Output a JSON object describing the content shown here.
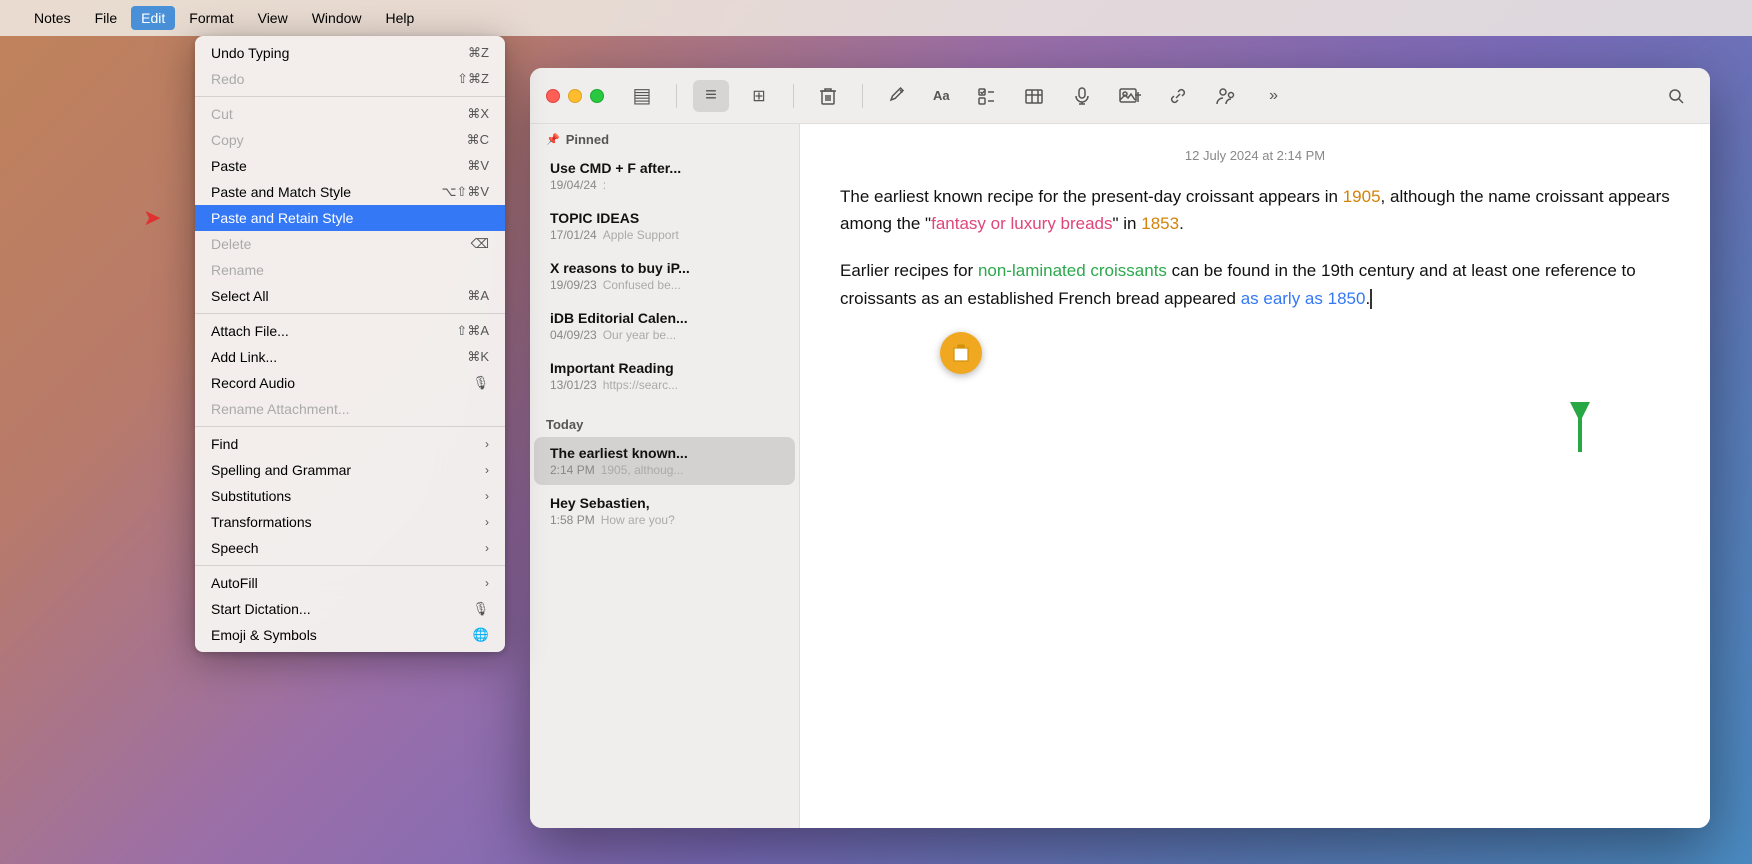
{
  "menuBar": {
    "apple": "",
    "items": [
      {
        "label": "Notes",
        "active": false
      },
      {
        "label": "File",
        "active": false
      },
      {
        "label": "Edit",
        "active": true
      },
      {
        "label": "Format",
        "active": false
      },
      {
        "label": "View",
        "active": false
      },
      {
        "label": "Window",
        "active": false
      },
      {
        "label": "Help",
        "active": false
      }
    ]
  },
  "dropdown": {
    "items": [
      {
        "id": "undo-typing",
        "label": "Undo Typing",
        "shortcut": "⌘Z",
        "disabled": false,
        "separator_after": false
      },
      {
        "id": "redo",
        "label": "Redo",
        "shortcut": "⇧⌘Z",
        "disabled": true,
        "separator_after": true
      },
      {
        "id": "cut",
        "label": "Cut",
        "shortcut": "⌘X",
        "disabled": true,
        "separator_after": false
      },
      {
        "id": "copy",
        "label": "Copy",
        "shortcut": "⌘C",
        "disabled": true,
        "separator_after": false
      },
      {
        "id": "paste",
        "label": "Paste",
        "shortcut": "⌘V",
        "disabled": false,
        "separator_after": false
      },
      {
        "id": "paste-match-style",
        "label": "Paste and Match Style",
        "shortcut": "⌥⇧⌘V",
        "disabled": false,
        "separator_after": false
      },
      {
        "id": "paste-retain-style",
        "label": "Paste and Retain Style",
        "shortcut": "",
        "disabled": false,
        "highlighted": true,
        "separator_after": false
      },
      {
        "id": "delete",
        "label": "Delete",
        "shortcut": "⌫",
        "disabled": true,
        "separator_after": false
      },
      {
        "id": "rename",
        "label": "Rename",
        "shortcut": "",
        "disabled": true,
        "separator_after": false
      },
      {
        "id": "select-all",
        "label": "Select All",
        "shortcut": "⌘A",
        "disabled": false,
        "separator_after": true
      },
      {
        "id": "attach-file",
        "label": "Attach File...",
        "shortcut": "⇧⌘A",
        "disabled": false,
        "separator_after": false
      },
      {
        "id": "add-link",
        "label": "Add Link...",
        "shortcut": "⌘K",
        "disabled": false,
        "separator_after": false
      },
      {
        "id": "record-audio",
        "label": "Record Audio",
        "shortcut": "🎙",
        "disabled": false,
        "separator_after": false
      },
      {
        "id": "rename-attachment",
        "label": "Rename Attachment...",
        "shortcut": "",
        "disabled": true,
        "separator_after": true
      },
      {
        "id": "find",
        "label": "Find",
        "shortcut": "",
        "arrow": true,
        "disabled": false,
        "separator_after": false
      },
      {
        "id": "spelling-grammar",
        "label": "Spelling and Grammar",
        "shortcut": "",
        "arrow": true,
        "disabled": false,
        "separator_after": false
      },
      {
        "id": "substitutions",
        "label": "Substitutions",
        "shortcut": "",
        "arrow": true,
        "disabled": false,
        "separator_after": false
      },
      {
        "id": "transformations",
        "label": "Transformations",
        "shortcut": "",
        "arrow": true,
        "disabled": false,
        "separator_after": false
      },
      {
        "id": "speech",
        "label": "Speech",
        "shortcut": "",
        "arrow": true,
        "disabled": false,
        "separator_after": true
      },
      {
        "id": "autofill",
        "label": "AutoFill",
        "shortcut": "",
        "arrow": true,
        "disabled": false,
        "separator_after": false
      },
      {
        "id": "start-dictation",
        "label": "Start Dictation...",
        "shortcut": "🎙",
        "disabled": false,
        "separator_after": false
      },
      {
        "id": "emoji-symbols",
        "label": "Emoji & Symbols",
        "shortcut": "🌐",
        "disabled": false,
        "separator_after": false
      }
    ]
  },
  "toolbar": {
    "buttons": [
      {
        "id": "sidebar-toggle",
        "icon": "▤",
        "label": "sidebar toggle"
      },
      {
        "id": "list-view",
        "icon": "≡",
        "label": "list view",
        "active": true
      },
      {
        "id": "gallery-view",
        "icon": "⊞",
        "label": "gallery view"
      },
      {
        "id": "trash",
        "icon": "🗑",
        "label": "trash"
      },
      {
        "id": "compose",
        "icon": "✏",
        "label": "compose"
      },
      {
        "id": "format-aa",
        "icon": "Aa",
        "label": "format"
      },
      {
        "id": "checklist",
        "icon": "☑",
        "label": "checklist"
      },
      {
        "id": "table",
        "icon": "⊞",
        "label": "table"
      },
      {
        "id": "audio",
        "icon": "🎵",
        "label": "audio"
      },
      {
        "id": "photo",
        "icon": "🖼",
        "label": "photo"
      },
      {
        "id": "link",
        "icon": "🔗",
        "label": "link"
      },
      {
        "id": "collab",
        "icon": "👥",
        "label": "collaborate"
      },
      {
        "id": "more",
        "icon": "»",
        "label": "more"
      },
      {
        "id": "search",
        "icon": "🔍",
        "label": "search"
      }
    ]
  },
  "sidebar": {
    "pinned_label": "Pinned",
    "today_label": "Today",
    "notes": [
      {
        "id": "use-cmd-f",
        "title": "Use CMD + F after...",
        "date": "19/04/24",
        "preview": ":",
        "pinned": true
      },
      {
        "id": "topic-ideas",
        "title": "TOPIC IDEAS",
        "date": "17/01/24",
        "preview": "Apple Support",
        "pinned": true
      },
      {
        "id": "x-reasons",
        "title": "X reasons to buy iP...",
        "date": "19/09/23",
        "preview": "Confused be...",
        "pinned": true
      },
      {
        "id": "idb-editorial",
        "title": "iDB Editorial Calen...",
        "date": "04/09/23",
        "preview": "Our year be...",
        "pinned": true
      },
      {
        "id": "important-reading",
        "title": "Important Reading",
        "date": "13/01/23",
        "preview": "https://searc...",
        "pinned": true
      },
      {
        "id": "earliest-known",
        "title": "The earliest known...",
        "date": "2:14 PM",
        "preview": "1905, althoug...",
        "today": true,
        "active": true
      },
      {
        "id": "hey-sebastien",
        "title": "Hey Sebastien,",
        "date": "1:58 PM",
        "preview": "How are you?",
        "today": true
      }
    ]
  },
  "note": {
    "timestamp": "12 July 2024 at 2:14 PM",
    "paragraph1": {
      "text1": "The earliest known recipe for the present-day croissant appears in ",
      "date1": "1905",
      "text2": ", although the name croissant appears among the \"",
      "link1": "fantasy or luxury breads",
      "text3": "\" in ",
      "date2": "1853",
      "text4": "."
    },
    "paragraph2": {
      "text1": "Earlier recipes for ",
      "link1": "non-laminated croissants",
      "text2": " can be found in the 19th century and at least one reference to croissants as an established French bread appeared ",
      "link2": "as early as 1850",
      "text3": "."
    }
  },
  "paste_bubble_icon": "⬆",
  "green_arrow": "↑"
}
